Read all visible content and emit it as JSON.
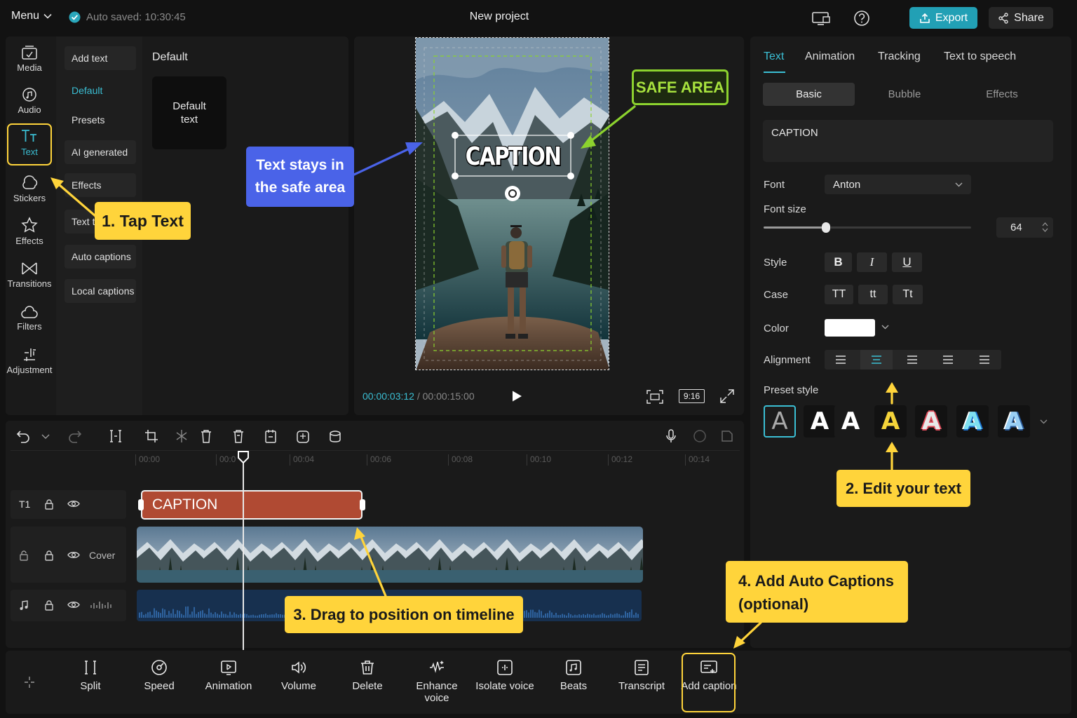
{
  "header": {
    "menu_label": "Menu",
    "autosave": "Auto saved: 10:30:45",
    "project_title": "New project",
    "export_label": "Export",
    "share_label": "Share"
  },
  "left_nav": [
    {
      "label": "Media",
      "icon": "media-icon"
    },
    {
      "label": "Audio",
      "icon": "audio-icon"
    },
    {
      "label": "Text",
      "icon": "text-icon",
      "active": true
    },
    {
      "label": "Stickers",
      "icon": "stickers-icon"
    },
    {
      "label": "Effects",
      "icon": "effects-icon"
    },
    {
      "label": "Transitions",
      "icon": "transitions-icon"
    },
    {
      "label": "Filters",
      "icon": "filters-icon"
    },
    {
      "label": "Adjustment",
      "icon": "adjustment-icon"
    }
  ],
  "text_submenu": [
    "Add text",
    "Default",
    "Presets",
    "AI generated",
    "Effects",
    "Text t",
    "Auto captions",
    "Local captions"
  ],
  "library": {
    "title": "Default",
    "card_line1": "Default",
    "card_line2": "text"
  },
  "preview": {
    "caption_text": "CAPTION",
    "current_time": "00:00:03:12",
    "separator": "/",
    "duration": "00:00:15:00",
    "aspect_ratio": "9:16"
  },
  "inspector": {
    "tabs": [
      "Text",
      "Animation",
      "Tracking",
      "Text to speech"
    ],
    "subtabs": [
      "Basic",
      "Bubble",
      "Effects"
    ],
    "text_value": "CAPTION",
    "font_label": "Font",
    "font_value": "Anton",
    "font_size_label": "Font size",
    "font_size_value": "64",
    "font_size_fraction": 0.3,
    "style_label": "Style",
    "style_buttons": [
      "B",
      "I",
      "U"
    ],
    "case_label": "Case",
    "case_buttons": [
      "TT",
      "tt",
      "Tt"
    ],
    "color_label": "Color",
    "color_value": "#ffffff",
    "alignment_label": "Alignment",
    "preset_label": "Preset style",
    "preset_glyph": "A"
  },
  "timeline": {
    "ruler": [
      "00:00",
      "00:0",
      "00:04",
      "00:06",
      "00:08",
      "00:10",
      "00:12",
      "00:14"
    ],
    "text_track_label": "T1",
    "video_track_label": "Cover",
    "caption_clip": "CAPTION"
  },
  "bottom_toolbar": [
    {
      "label": "Split",
      "icon": "split-icon"
    },
    {
      "label": "Speed",
      "icon": "speed-icon"
    },
    {
      "label": "Animation",
      "icon": "animation-icon"
    },
    {
      "label": "Volume",
      "icon": "volume-icon"
    },
    {
      "label": "Delete",
      "icon": "delete-icon"
    },
    {
      "label": "Enhance voice",
      "icon": "enhance-voice-icon"
    },
    {
      "label": "Isolate voice",
      "icon": "isolate-voice-icon"
    },
    {
      "label": "Beats",
      "icon": "beats-icon"
    },
    {
      "label": "Transcript",
      "icon": "transcript-icon"
    },
    {
      "label": "Add caption",
      "icon": "add-caption-icon"
    }
  ],
  "annotations": {
    "step1": "1. Tap Text",
    "step2": "2. Edit your text",
    "step3": "3. Drag to position on timeline",
    "step4_line1": "4. Add Auto Captions",
    "step4_line2": "(optional)",
    "safe_hint_line1": "Text stays in",
    "safe_hint_line2": "the safe area",
    "safe_area": "SAFE AREA"
  },
  "colors": {
    "accent": "#3bbfd4",
    "callout": "#ffd43b",
    "caption_clip": "#b04a33",
    "safe_area": "#8cd22e",
    "blue_callout": "#4a63e8"
  }
}
